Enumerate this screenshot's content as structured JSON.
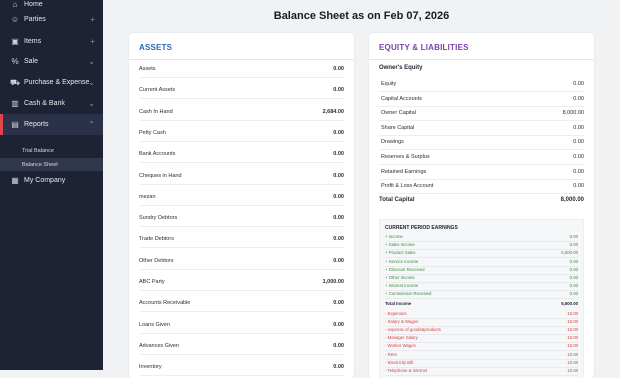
{
  "colors": {
    "sidebar_bg": "#1d2235",
    "active_bar": "#e0444d",
    "assets_heading": "#2c67b3",
    "equity_heading": "#7a3fb0",
    "income": "#3f8a46",
    "expense": "#d04545"
  },
  "sidebar": {
    "items": [
      {
        "label": "Home",
        "icon": "home-icon"
      },
      {
        "label": "Parties",
        "icon": "users-icon",
        "aux": "+"
      },
      {
        "label": "Items",
        "icon": "box-icon",
        "aux": "+"
      },
      {
        "label": "Sale",
        "icon": "percent-icon",
        "aux": "⌄"
      },
      {
        "label": "Purchase & Expense",
        "icon": "cart-icon",
        "aux": "⌄"
      },
      {
        "label": "Cash & Bank",
        "icon": "bank-icon",
        "aux": "⌄"
      },
      {
        "label": "Reports",
        "icon": "report-icon",
        "aux": "⌃"
      },
      {
        "label": "My Company",
        "icon": "company-icon"
      }
    ],
    "sub_items": [
      "Trial Balance",
      "Balance Sheet"
    ]
  },
  "page": {
    "title": "Balance Sheet as on Feb 07, 2026"
  },
  "assets": {
    "heading": "ASSETS",
    "rows": [
      {
        "label": "Assets",
        "value": "0.00"
      },
      {
        "label": "Current Assets",
        "value": "0.00"
      },
      {
        "label": "Cash In Hand",
        "value": "2,684.00"
      },
      {
        "label": "Petty Cash",
        "value": "0.00"
      },
      {
        "label": "Bank Accounts",
        "value": "0.00"
      },
      {
        "label": "Cheques in Hand",
        "value": "0.00"
      },
      {
        "label": "mezan",
        "value": "0.00"
      },
      {
        "label": "Sundry Debtors",
        "value": "0.00"
      },
      {
        "label": "Trade Debtors",
        "value": "0.00"
      },
      {
        "label": "Other Debtors",
        "value": "0.00"
      },
      {
        "label": "ABC Party",
        "value": "1,000.00"
      },
      {
        "label": "Accounts Receivable",
        "value": "0.00"
      },
      {
        "label": "Loans Given",
        "value": "0.00"
      },
      {
        "label": "Advances Given",
        "value": "0.00"
      },
      {
        "label": "Inventory",
        "value": "0.00"
      }
    ]
  },
  "equity": {
    "heading": "EQUITY & LIABILITIES",
    "section": "Owner's Equity",
    "rows": [
      {
        "label": "Equity",
        "value": "0.00"
      },
      {
        "label": "Capital Accounts",
        "value": "0.00"
      },
      {
        "label": "Owner Capital",
        "value": "8,000.00"
      },
      {
        "label": "Share Capital",
        "value": "0.00"
      },
      {
        "label": "Drawings",
        "value": "0.00"
      },
      {
        "label": "Reserves & Surplus",
        "value": "0.00"
      },
      {
        "label": "Retained Earnings",
        "value": "0.00"
      },
      {
        "label": "Profit & Loss Account",
        "value": "0.00"
      }
    ],
    "total_label": "Total Capital",
    "total_value": "8,000.00"
  },
  "cpe": {
    "title": "CURRENT PERIOD EARNINGS",
    "income_rows": [
      {
        "label": "+ Income",
        "value": "0.00"
      },
      {
        "label": "+ Sales Income",
        "value": "0.00"
      },
      {
        "label": "+ Product Sales",
        "value": "5,500.00"
      },
      {
        "label": "+ Service Income",
        "value": "0.00"
      },
      {
        "label": "+ Discount Received",
        "value": "0.00"
      },
      {
        "label": "+ Other Income",
        "value": "0.00"
      },
      {
        "label": "+ Interest Income",
        "value": "0.00"
      },
      {
        "label": "+ Commission Received",
        "value": "0.00"
      }
    ],
    "total_income_label": "Total Income",
    "total_income_value": "5,500.00",
    "expense_rows": [
      {
        "label": "- Expenses",
        "value": "10.00"
      },
      {
        "label": "- Salary & Wages",
        "value": "10.00"
      },
      {
        "label": "- expense of goods&products",
        "value": "10.00"
      },
      {
        "label": "- Manager Salary",
        "value": "10.00"
      },
      {
        "label": "- Worker Wages",
        "value": "10.00"
      },
      {
        "label": "- Rent",
        "value": "10.00"
      },
      {
        "label": "- Electricity Bill",
        "value": "10.00"
      },
      {
        "label": "- Telephone & Internet",
        "value": "10.00"
      }
    ]
  }
}
